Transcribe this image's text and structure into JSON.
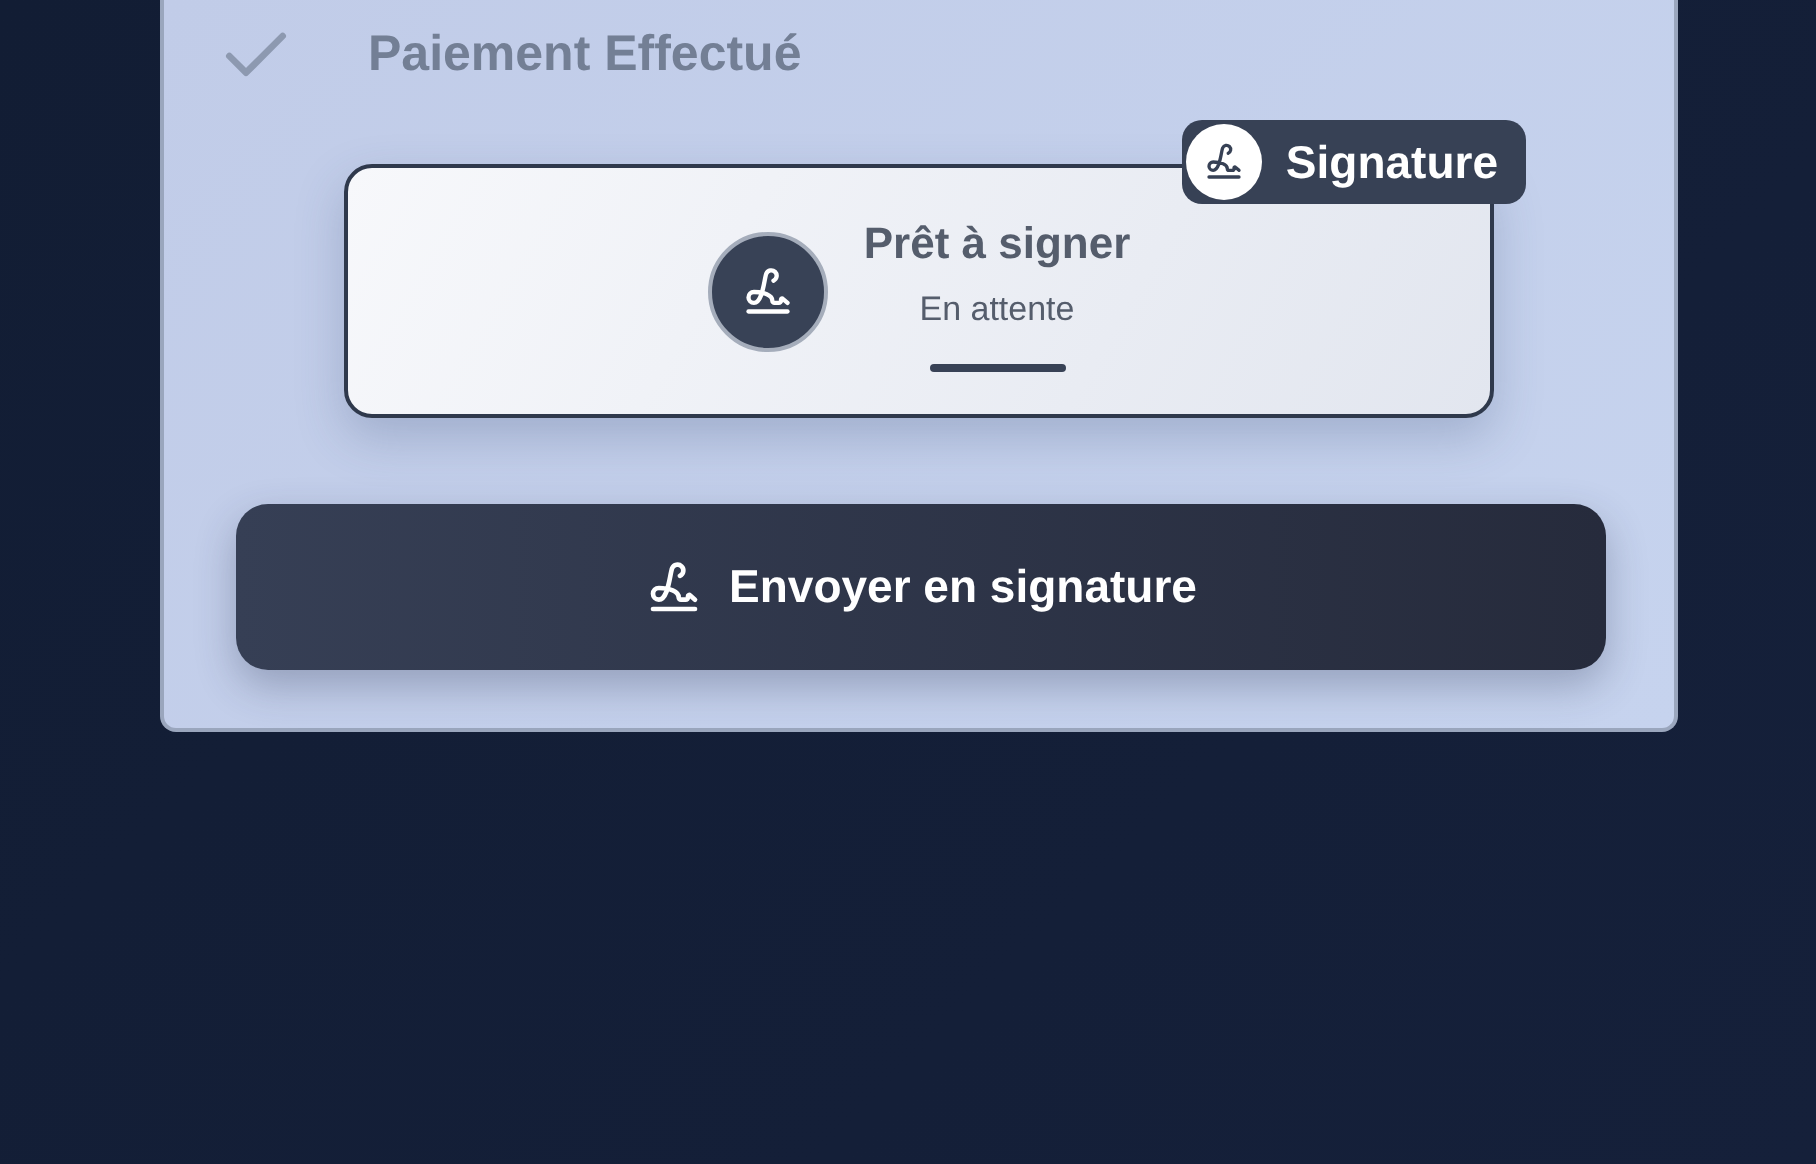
{
  "step": {
    "label": "Paiement Effectué",
    "checked": true
  },
  "card": {
    "badge": "Signature",
    "title": "Prêt à signer",
    "status": "En attente"
  },
  "button": {
    "label": "Envoyer en signature"
  }
}
